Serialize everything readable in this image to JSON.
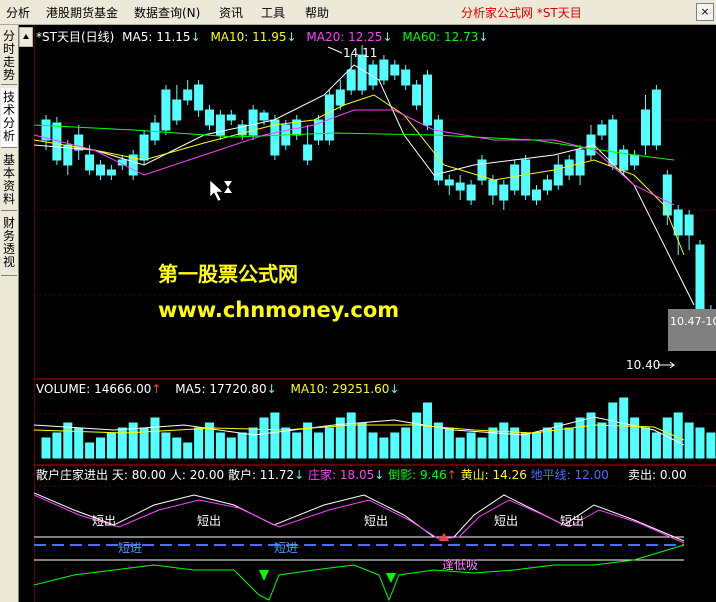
{
  "menu": {
    "items": [
      "分析",
      "港股期货基金",
      "数据查询(N)",
      "资讯",
      "工具",
      "帮助"
    ],
    "title": "分析家公式网 *ST天目",
    "close": "×"
  },
  "sidebar": {
    "tabs": [
      "分时走势",
      "技术分析",
      "基本资料",
      "财务透视"
    ],
    "active_tab": "技术分析"
  },
  "main_panel": {
    "legend": {
      "stock": "*ST天目(日线)",
      "ma5": "MA5: 11.15",
      "ma10": "MA10: 11.95",
      "ma20": "MA20: 12.25",
      "ma60": "MA60: 12.73"
    },
    "high_label": "14.11",
    "low_label": "10.40",
    "right_price_label": "10.47-10",
    "colors": {
      "up": "#ff3c3c",
      "down": "#54ffff",
      "ma5": "#ffffff",
      "ma10": "#ffff00",
      "ma20": "#ff40ff",
      "ma60": "#00ff00"
    }
  },
  "watermark": {
    "line1": "第一股票公式网",
    "line2": "www.chnmoney.com"
  },
  "volume_panel": {
    "legend": {
      "volume": "VOLUME: 14666.00",
      "ma5": "MA5: 17720.80",
      "ma10": "MA10: 29251.60"
    }
  },
  "indicator_panel": {
    "legend": {
      "name": "散户庄家进出",
      "tian": "天: 80.00",
      "ren": "人: 20.00",
      "sanhu": "散户: 11.72",
      "zhuangjia": "庄家: 18.05",
      "daoying": "倒影: 9.46",
      "huangshan": "黄山: 14.26",
      "dipingxian": "地平线: 12.00",
      "maichu": "卖出: 0.00"
    },
    "labels": {
      "short_out": "短出",
      "short_in": "短进",
      "buy_low": "逢低吸"
    }
  },
  "chart_data": {
    "type": "candlestick",
    "high": 14.11,
    "low": 10.4,
    "ma_values": {
      "MA5": 11.15,
      "MA10": 11.95,
      "MA20": 12.25,
      "MA60": 12.73
    },
    "volume": {
      "VOLUME": 14666.0,
      "MA5": 17720.8,
      "MA10": 29251.6
    },
    "indicator": {
      "天": 80.0,
      "人": 20.0,
      "散户": 11.72,
      "庄家": 18.05,
      "倒影": 9.46,
      "黄山": 14.26,
      "地平线": 12.0,
      "卖出": 0.0
    }
  }
}
